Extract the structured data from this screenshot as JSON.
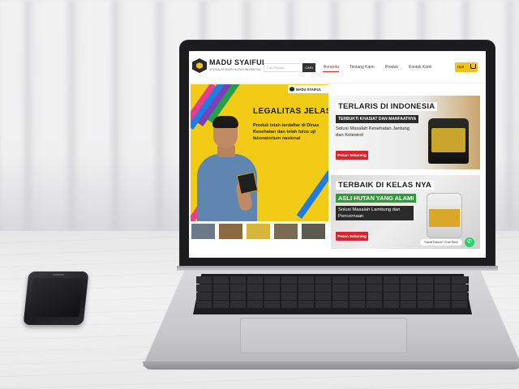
{
  "site": {
    "brand": "MADU SYAIFUL",
    "tagline": "SPESIALIS MADU HUTAN INDONESIA",
    "search_placeholder": "Cari Produk",
    "search_button": "CARI",
    "menu": [
      "Beranda",
      "Tentang Kami",
      "Produk",
      "Kontak Kami"
    ],
    "active_menu": "Beranda",
    "cart_label": "Rp0"
  },
  "hero": {
    "badge": "MADU SYAIFUL",
    "title": "LEGALITAS JELAS",
    "description": "Produk telah terdaftar di Dinas Kesehatan dan telah lulus uji laboratorium nasional"
  },
  "cards": [
    {
      "title": "TERLARIS DI INDONESIA",
      "subtitle": "TERBUKTI KHASIAT DAN MANFAATNYA",
      "description": "Solusi Masalah Kesehatan Jantung dan Kolestrol",
      "button": "Pesan Sekarang"
    },
    {
      "title": "TERBAIK DI KELAS NYA",
      "subtitle": "ASLI HUTAN YANG ALAMI",
      "description": "Solusi Masalah Lambung dan Pencernaan",
      "button": "Pesan Sekarang",
      "chat_label": "Solusi Diskon? Chat Kami"
    }
  ],
  "colors": {
    "accent": "#f2c21a",
    "cta": "#d9232d",
    "whatsapp": "#25d366"
  },
  "icons": [
    "search-icon",
    "cart-icon",
    "whatsapp-icon"
  ]
}
